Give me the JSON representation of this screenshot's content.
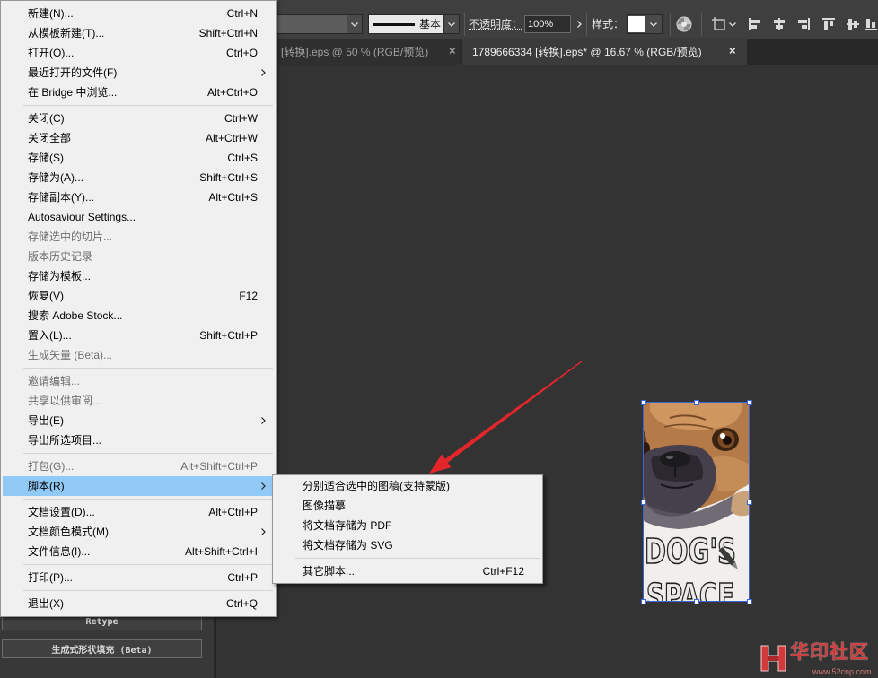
{
  "control_bar": {
    "brush_label": "基本",
    "opacity_label": "不透明度：",
    "opacity_value": "100%",
    "style_label": "样式：",
    "icons": [
      "chevron-down-icon",
      "chevron-right-icon",
      "recolor-artwork-icon",
      "artboard-icon",
      "align-left-icon",
      "align-horizontal-center-icon",
      "align-right-icon",
      "align-top-icon",
      "align-vertical-center-icon",
      "align-bottom-icon"
    ]
  },
  "tabs": [
    {
      "label": "[转换].eps @ 50 % (RGB/预览)",
      "close": "×",
      "active": false
    },
    {
      "label": "1789666334  [转换].eps* @ 16.67 % (RGB/预览)",
      "close": "×",
      "active": true
    }
  ],
  "file_menu": {
    "items": [
      {
        "label": "新建(N)...",
        "shortcut": "Ctrl+N"
      },
      {
        "label": "从模板新建(T)...",
        "shortcut": "Shift+Ctrl+N"
      },
      {
        "label": "打开(O)...",
        "shortcut": "Ctrl+O"
      },
      {
        "label": "最近打开的文件(F)",
        "submenu": true
      },
      {
        "label": "在 Bridge 中浏览...",
        "shortcut": "Alt+Ctrl+O"
      },
      {
        "label": "关闭(C)",
        "shortcut": "Ctrl+W"
      },
      {
        "label": "关闭全部",
        "shortcut": "Alt+Ctrl+W"
      },
      {
        "label": "存储(S)",
        "shortcut": "Ctrl+S"
      },
      {
        "label": "存储为(A)...",
        "shortcut": "Shift+Ctrl+S"
      },
      {
        "label": "存储副本(Y)...",
        "shortcut": "Alt+Ctrl+S"
      },
      {
        "label": "Autosaviour Settings..."
      },
      {
        "label": "存储选中的切片...",
        "disabled": true
      },
      {
        "label": "版本历史记录",
        "disabled": true
      },
      {
        "label": "存储为模板..."
      },
      {
        "label": "恢复(V)",
        "shortcut": "F12"
      },
      {
        "label": "搜索 Adobe Stock..."
      },
      {
        "label": "置入(L)...",
        "shortcut": "Shift+Ctrl+P"
      },
      {
        "label": "生成矢量 (Beta)...",
        "disabled": true
      },
      {
        "label": "邀请编辑...",
        "disabled": true
      },
      {
        "label": "共享以供审阅...",
        "disabled": true
      },
      {
        "label": "导出(E)",
        "submenu": true
      },
      {
        "label": "导出所选项目..."
      },
      {
        "label": "打包(G)...",
        "shortcut": "Alt+Shift+Ctrl+P",
        "disabled": true
      },
      {
        "label": "脚本(R)",
        "submenu": true,
        "highlighted": true
      },
      {
        "label": "文档设置(D)...",
        "shortcut": "Alt+Ctrl+P"
      },
      {
        "label": "文档颜色模式(M)",
        "submenu": true
      },
      {
        "label": "文件信息(I)...",
        "shortcut": "Alt+Shift+Ctrl+I"
      },
      {
        "label": "打印(P)...",
        "shortcut": "Ctrl+P"
      },
      {
        "label": "退出(X)",
        "shortcut": "Ctrl+Q"
      }
    ]
  },
  "scripts_submenu": {
    "items": [
      {
        "label": "分别适合选中的图稿(支持蒙版)"
      },
      {
        "label": "图像描摹"
      },
      {
        "label": "将文档存储为 PDF"
      },
      {
        "label": "将文档存储为 SVG"
      },
      {
        "label": "其它脚本...",
        "shortcut": "Ctrl+F12"
      }
    ]
  },
  "panel": {
    "buttons": [
      {
        "label": "Retype"
      },
      {
        "label": "生成式形状填充 (Beta)"
      }
    ]
  },
  "artwork": {
    "line1": "DOG'S",
    "line2": "SPACE"
  },
  "watermark": {
    "brand": "华印社区",
    "url": "www.52cnp.com"
  },
  "colors": {
    "menu_highlight": "#91c9f7",
    "selection": "#3c63d8",
    "annotation_arrow": "#e3262b",
    "canvas": "#333333"
  }
}
